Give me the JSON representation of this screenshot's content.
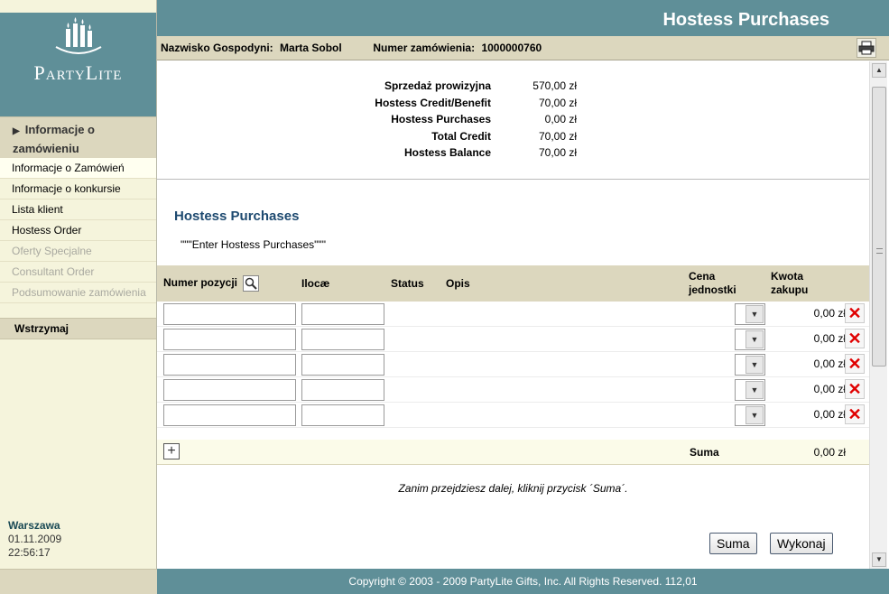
{
  "brand": {
    "name": "PartyLite"
  },
  "sidebar": {
    "section_title": "Informacje o zamówieniu",
    "items": [
      {
        "label": "Informacje o Zamówień",
        "state": "active"
      },
      {
        "label": "Informacje o konkursie",
        "state": "normal"
      },
      {
        "label": "Lista klient",
        "state": "normal"
      },
      {
        "label": "Hostess Order",
        "state": "normal"
      },
      {
        "label": "Oferty Specjalne",
        "state": "disabled"
      },
      {
        "label": "Consultant Order",
        "state": "disabled"
      },
      {
        "label": "Podsumowanie zamówienia",
        "state": "disabled"
      }
    ],
    "hold_label": "Wstrzymaj",
    "location": "Warszawa",
    "date": "01.11.2009",
    "time": "22:56:17"
  },
  "header": {
    "title": "Hostess Purchases",
    "hostess_label": "Nazwisko Gospodyni:",
    "hostess_name": "Marta Sobol",
    "order_label": "Numer zamówienia:",
    "order_number": "1000000760",
    "print_icon": "printer-icon"
  },
  "summary": [
    {
      "label": "Sprzedaż prowizyjna",
      "value": "570,00 zł"
    },
    {
      "label": "Hostess Credit/Benefit",
      "value": "70,00 zł"
    },
    {
      "label": "Hostess Purchases",
      "value": "0,00 zł"
    },
    {
      "label": "Total Credit",
      "value": "70,00 zł"
    },
    {
      "label": "Hostess Balance",
      "value": "70,00 zł"
    }
  ],
  "purchases": {
    "title": "Hostess Purchases",
    "note": "\"\"\"Enter Hostess Purchases\"\"\"",
    "columns": {
      "item_number": "Numer pozycji",
      "quantity": "Ilocæ",
      "status": "Status",
      "description": "Opis",
      "unit_price_1": "Cena",
      "unit_price_2": "jednostki",
      "amount_1": "Kwota",
      "amount_2": "zakupu"
    },
    "rows": [
      {
        "item_number": "",
        "quantity": "",
        "amount": "0,00 zł"
      },
      {
        "item_number": "",
        "quantity": "",
        "amount": "0,00 zł"
      },
      {
        "item_number": "",
        "quantity": "",
        "amount": "0,00 zł"
      },
      {
        "item_number": "",
        "quantity": "",
        "amount": "0,00 zł"
      },
      {
        "item_number": "",
        "quantity": "",
        "amount": "0,00 zł"
      }
    ],
    "total_label": "Suma",
    "total_value": "0,00 zł",
    "hint": "Zanim przejdziesz dalej, kliknij przycisk ´Suma´.",
    "buttons": {
      "sum": "Suma",
      "execute": "Wykonaj"
    }
  },
  "footer": {
    "copyright": "Copyright © 2003 - 2009 PartyLite Gifts, Inc. All Rights Reserved.  112,01"
  },
  "colors": {
    "header_teal": "#5f8f98",
    "sidebar_tan": "#dcd7be",
    "sidebar_bg": "#f5f4dc",
    "title_blue": "#1e4a70",
    "delete_red": "#e00000"
  }
}
